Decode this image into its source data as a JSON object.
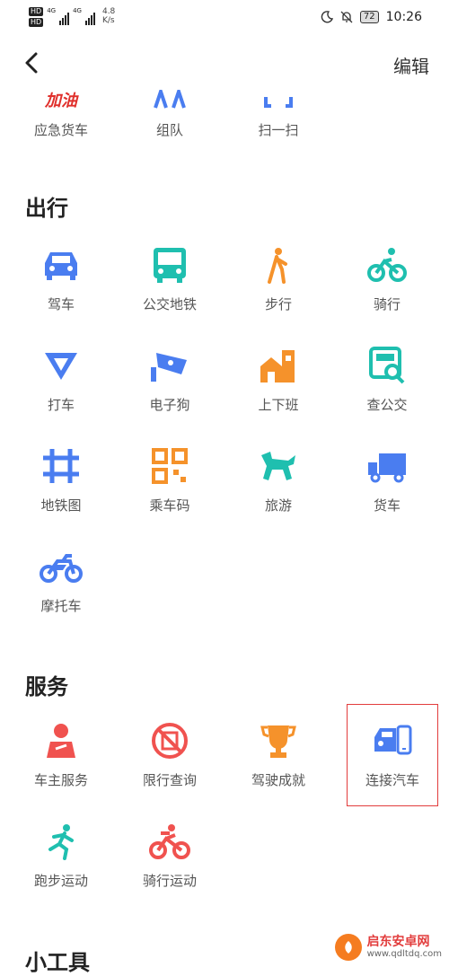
{
  "status_bar": {
    "hd1": "HD",
    "hd2": "HD",
    "net1": "4G",
    "net2": "4G",
    "speed_value": "4.8",
    "speed_unit": "K/s",
    "battery": "72",
    "time": "10:26"
  },
  "header": {
    "edit_label": "编辑"
  },
  "top_row": [
    {
      "label": "应急货车",
      "icon": "fuel-text-icon",
      "extra": "加油"
    },
    {
      "label": "组队",
      "icon": "team-icon"
    },
    {
      "label": "扫一扫",
      "icon": "scan-icon"
    }
  ],
  "sections": {
    "travel": {
      "title": "出行",
      "items": [
        {
          "label": "驾车",
          "icon": "car-icon"
        },
        {
          "label": "公交地铁",
          "icon": "bus-icon"
        },
        {
          "label": "步行",
          "icon": "walk-icon"
        },
        {
          "label": "骑行",
          "icon": "bicycle-icon"
        },
        {
          "label": "打车",
          "icon": "taxi-icon"
        },
        {
          "label": "电子狗",
          "icon": "camera-icon"
        },
        {
          "label": "上下班",
          "icon": "commute-icon"
        },
        {
          "label": "查公交",
          "icon": "bus-search-icon"
        },
        {
          "label": "地铁图",
          "icon": "subway-map-icon"
        },
        {
          "label": "乘车码",
          "icon": "qr-code-icon"
        },
        {
          "label": "旅游",
          "icon": "horse-icon"
        },
        {
          "label": "货车",
          "icon": "truck-icon"
        },
        {
          "label": "摩托车",
          "icon": "motorcycle-icon"
        }
      ]
    },
    "service": {
      "title": "服务",
      "items": [
        {
          "label": "车主服务",
          "icon": "owner-icon"
        },
        {
          "label": "限行查询",
          "icon": "restriction-icon"
        },
        {
          "label": "驾驶成就",
          "icon": "trophy-icon"
        },
        {
          "label": "连接汽车",
          "icon": "connect-car-icon"
        },
        {
          "label": "跑步运动",
          "icon": "running-icon"
        },
        {
          "label": "骑行运动",
          "icon": "cycling-sport-icon"
        }
      ]
    },
    "tools": {
      "title": "小工具"
    }
  },
  "watermark": {
    "title": "启东安卓网",
    "url": "www.qdltdq.com"
  },
  "colors": {
    "blue": "#4a7df0",
    "teal": "#1fbfaf",
    "orange": "#f5922b",
    "red": "#f0524f",
    "highlight": "#e23c3c"
  }
}
